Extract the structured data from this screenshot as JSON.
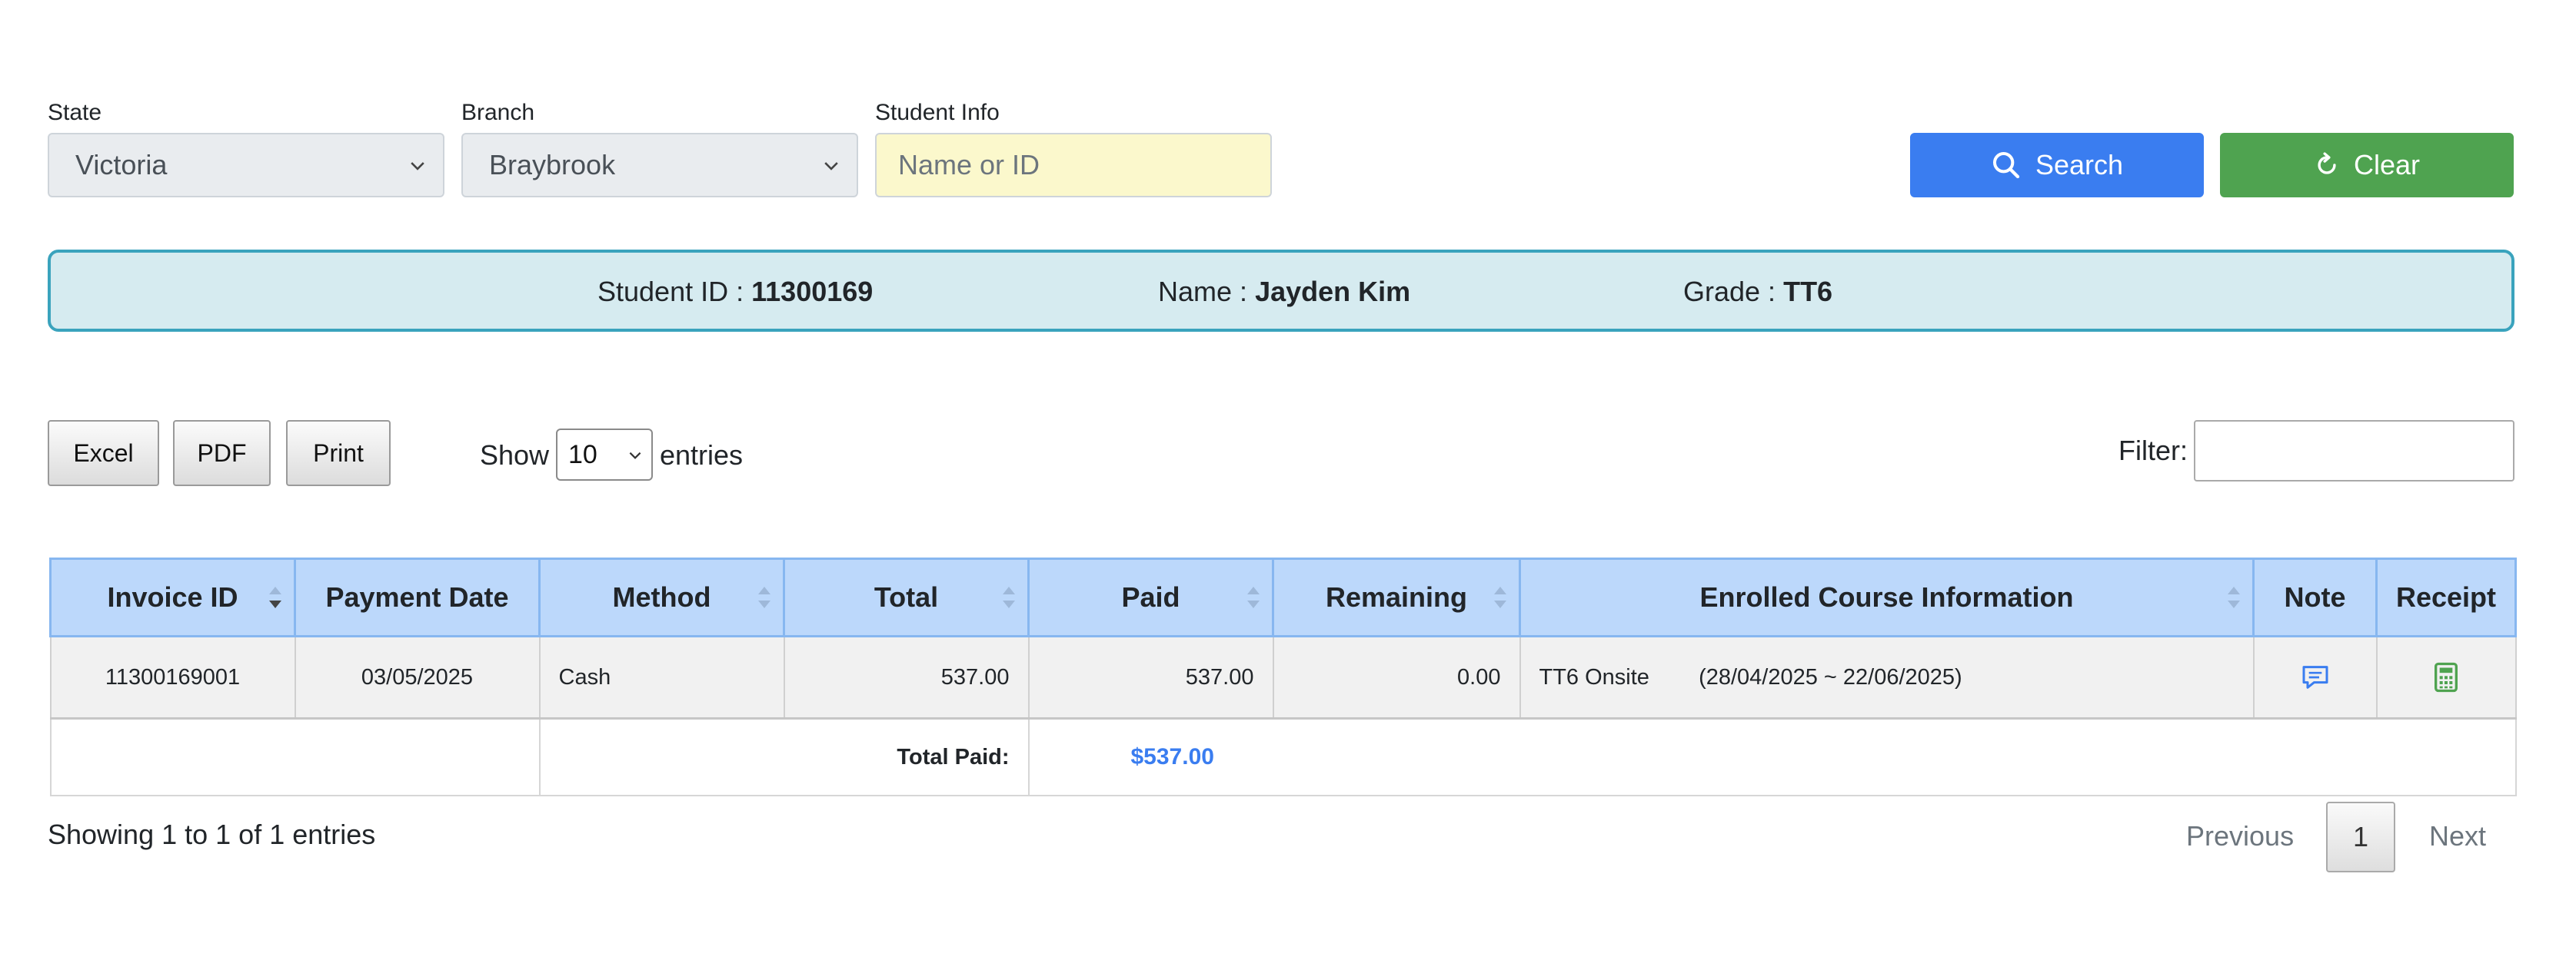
{
  "filters": {
    "state": {
      "label": "State",
      "value": "Victoria"
    },
    "branch": {
      "label": "Branch",
      "value": "Braybrook"
    },
    "student_info": {
      "label": "Student Info",
      "placeholder": "Name or ID"
    }
  },
  "actions": {
    "search_label": "Search",
    "clear_label": "Clear"
  },
  "student": {
    "id_label": "Student ID :",
    "id_value": "11300169",
    "name_label": "Name :",
    "name_value": "Jayden Kim",
    "grade_label": "Grade :",
    "grade_value": "TT6"
  },
  "toolbar": {
    "excel_label": "Excel",
    "pdf_label": "PDF",
    "print_label": "Print",
    "show_label": "Show",
    "entries_value": "10",
    "entries_label": "entries",
    "filter_label": "Filter:"
  },
  "table": {
    "headers": [
      "Invoice ID",
      "Payment Date",
      "Method",
      "Total",
      "Paid",
      "Remaining",
      "Enrolled Course Information",
      "Note",
      "Receipt"
    ],
    "rows": [
      {
        "invoice_id": "11300169001",
        "payment_date": "03/05/2025",
        "method": "Cash",
        "total": "537.00",
        "paid": "537.00",
        "remaining": "0.00",
        "course": "TT6 Onsite",
        "course_period": "(28/04/2025 ~ 22/06/2025)",
        "note_icon": "comment-icon",
        "receipt_icon": "calculator-icon"
      }
    ],
    "footer": {
      "total_paid_label": "Total Paid:",
      "total_paid_value": "$537.00"
    }
  },
  "pagination": {
    "summary": "Showing 1 to 1 of 1 entries",
    "previous_label": "Previous",
    "current_page": "1",
    "next_label": "Next"
  },
  "colors": {
    "search_button": "#3a7df0",
    "clear_button": "#4fa350",
    "header_background": "#bcd8fb",
    "info_box_border": "#3aa3bd",
    "total_paid_value": "#3a7df0"
  }
}
